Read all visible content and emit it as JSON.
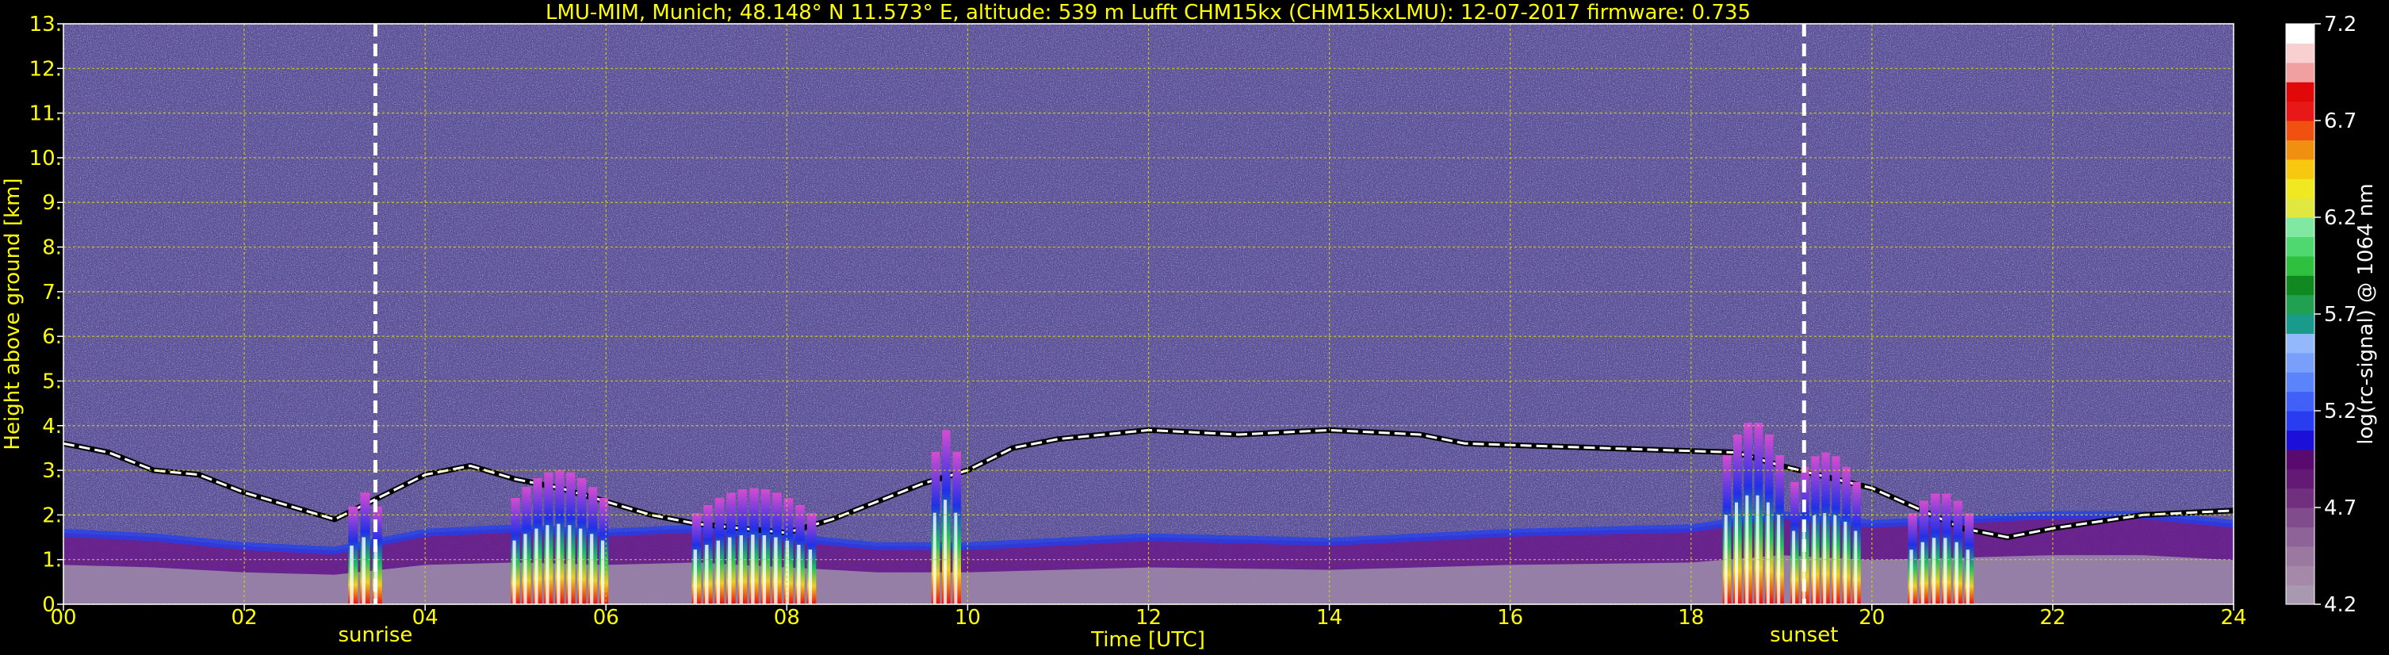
{
  "chart_data": {
    "type": "heatmap",
    "title": "LMU-MIM, Munich; 48.148° N 11.573° E, altitude: 539 m    Lufft CHM15kx (CHM15kxLMU): 12-07-2017    firmware: 0.735",
    "xlabel": "Time [UTC]",
    "ylabel": "Height above ground [km]",
    "xlim": [
      0,
      24
    ],
    "ylim": [
      0,
      13
    ],
    "x_ticks": [
      0,
      2,
      4,
      6,
      8,
      10,
      12,
      14,
      16,
      18,
      20,
      22,
      24
    ],
    "x_tick_labels": [
      "00",
      "02",
      "04",
      "06",
      "08",
      "10",
      "12",
      "14",
      "16",
      "18",
      "20",
      "22",
      "24"
    ],
    "y_ticks": [
      0,
      1,
      2,
      3,
      4,
      5,
      6,
      7,
      8,
      9,
      10,
      11,
      12,
      13
    ],
    "y_tick_labels": [
      "0.",
      "1.",
      "2.",
      "3.",
      "4.",
      "5.",
      "6.",
      "7.",
      "8.",
      "9.",
      "10.",
      "11.",
      "12.",
      "13."
    ],
    "grid": true,
    "events": [
      {
        "label": "sunrise",
        "x": 3.45
      },
      {
        "label": "sunset",
        "x": 19.25
      }
    ],
    "colorbar": {
      "label": "log(rc-signal) @ 1064 nm",
      "min": 4.2,
      "max": 7.2,
      "tick_values": [
        4.2,
        4.7,
        5.2,
        5.7,
        6.2,
        6.7,
        7.2
      ],
      "tick_labels": [
        "4.2",
        "4.7",
        "5.2",
        "5.7",
        "6.2",
        "6.7",
        "7.2"
      ],
      "colors": [
        "#a898b0",
        "#a48aa8",
        "#9a78a0",
        "#8e6498",
        "#804c8c",
        "#70307e",
        "#641a74",
        "#5a0a6e",
        "#1a10d8",
        "#2a3cf0",
        "#4060f8",
        "#5c84fa",
        "#78a0fa",
        "#94b8fc",
        "#1a9a8a",
        "#20a050",
        "#108a20",
        "#30c040",
        "#50d870",
        "#80e8a0",
        "#e0e840",
        "#f0e820",
        "#f8c810",
        "#f09010",
        "#f05010",
        "#e81818",
        "#e00808",
        "#f0a0a0",
        "#f8d0d0",
        "#ffffff"
      ]
    },
    "layers": [
      {
        "name": "pbl_aerosol",
        "points": [
          [
            0,
            1.6
          ],
          [
            1,
            1.5
          ],
          [
            2,
            1.3
          ],
          [
            3,
            1.2
          ],
          [
            4,
            1.6
          ],
          [
            5,
            1.7
          ],
          [
            6,
            1.6
          ],
          [
            7,
            1.7
          ],
          [
            8,
            1.5
          ],
          [
            9,
            1.3
          ],
          [
            10,
            1.3
          ],
          [
            12,
            1.5
          ],
          [
            14,
            1.4
          ],
          [
            16,
            1.6
          ],
          [
            18,
            1.7
          ],
          [
            19,
            2.0
          ],
          [
            20,
            1.8
          ],
          [
            21,
            1.9
          ],
          [
            22,
            2.0
          ],
          [
            23,
            2.0
          ],
          [
            24,
            1.8
          ]
        ]
      },
      {
        "name": "cloud_base_line",
        "points": [
          [
            0,
            3.6
          ],
          [
            0.5,
            3.4
          ],
          [
            1,
            3.0
          ],
          [
            1.5,
            2.9
          ],
          [
            2,
            2.5
          ],
          [
            2.5,
            2.2
          ],
          [
            3,
            1.9
          ],
          [
            3.5,
            2.4
          ],
          [
            4,
            2.9
          ],
          [
            4.5,
            3.1
          ],
          [
            5,
            2.8
          ],
          [
            5.5,
            2.6
          ],
          [
            6,
            2.3
          ],
          [
            6.5,
            2.0
          ],
          [
            7,
            1.8
          ],
          [
            7.5,
            1.7
          ],
          [
            8,
            1.6
          ],
          [
            8.5,
            1.9
          ],
          [
            9,
            2.3
          ],
          [
            9.5,
            2.7
          ],
          [
            10,
            3.0
          ],
          [
            10.5,
            3.5
          ],
          [
            11,
            3.7
          ],
          [
            12,
            3.9
          ],
          [
            13,
            3.8
          ],
          [
            14,
            3.9
          ],
          [
            15,
            3.8
          ],
          [
            15.5,
            3.6
          ],
          [
            18.5,
            3.4
          ],
          [
            19,
            3.1
          ],
          [
            20,
            2.6
          ],
          [
            21,
            1.7
          ],
          [
            21.5,
            1.5
          ],
          [
            22,
            1.7
          ],
          [
            23,
            2.0
          ],
          [
            24,
            2.1
          ]
        ]
      }
    ],
    "cloud_columns": [
      {
        "x0": 3.15,
        "x1": 3.55,
        "top": 2.5
      },
      {
        "x0": 4.95,
        "x1": 6.05,
        "top": 3.0
      },
      {
        "x0": 6.95,
        "x1": 8.35,
        "top": 2.6
      },
      {
        "x0": 9.6,
        "x1": 9.95,
        "top": 3.9
      },
      {
        "x0": 18.35,
        "x1": 19.05,
        "top": 4.1
      },
      {
        "x0": 19.1,
        "x1": 19.9,
        "top": 3.4
      },
      {
        "x0": 20.4,
        "x1": 21.15,
        "top": 2.5
      }
    ],
    "colors": {
      "background": "#000000",
      "text": "#ffff00",
      "grid": "#d8d800",
      "noise_mean": "#5a4a8e",
      "event_line": "#ffffff"
    }
  }
}
